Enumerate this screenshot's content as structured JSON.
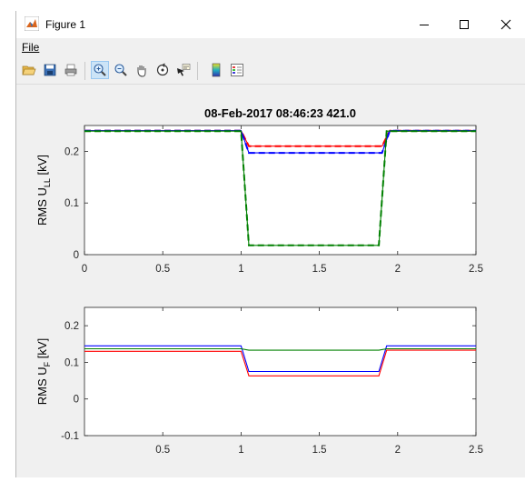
{
  "window": {
    "title": "Figure 1",
    "app_icon": "matlab-icon"
  },
  "controls": {
    "minimize": "minimize-icon",
    "maximize": "maximize-icon",
    "close": "close-icon"
  },
  "menu": {
    "file": "File"
  },
  "toolbar": {
    "items": [
      {
        "name": "open-file",
        "icon": "folder-open-icon"
      },
      {
        "name": "save",
        "icon": "save-icon"
      },
      {
        "name": "print",
        "icon": "print-icon"
      },
      {
        "name": "zoom-in",
        "icon": "zoom-in-icon",
        "active": true
      },
      {
        "name": "zoom-out",
        "icon": "zoom-out-icon"
      },
      {
        "name": "pan",
        "icon": "pan-hand-icon"
      },
      {
        "name": "rotate-3d",
        "icon": "rotate-icon"
      },
      {
        "name": "data-cursor",
        "icon": "data-cursor-icon"
      },
      {
        "name": "colorbar",
        "icon": "colorbar-icon"
      },
      {
        "name": "legend",
        "icon": "legend-icon"
      }
    ]
  },
  "colors": {
    "blue": "#0000ff",
    "red": "#ff0000",
    "green": "#008000"
  },
  "chart_data": [
    {
      "type": "line",
      "title": "08-Feb-2017 08:46:23 421.0",
      "ylabel": "RMS U",
      "ylabel_sub": "LL",
      "ylabel_unit": " [kV]",
      "xlim": [
        0,
        2.5
      ],
      "ylim": [
        0,
        0.25
      ],
      "xticks": [
        "0",
        "0.5",
        "1",
        "1.5",
        "2",
        "2.5"
      ],
      "xtick_values": [
        0,
        0.5,
        1,
        1.5,
        2,
        2.5
      ],
      "yticks": [
        "0",
        "0.1",
        "0.2"
      ],
      "ytick_values": [
        0,
        0.1,
        0.2
      ],
      "series": [
        {
          "color": "red",
          "style": "solid",
          "x": [
            0,
            1.0,
            1.05,
            1.9,
            1.95,
            2.5
          ],
          "y": [
            0.24,
            0.24,
            0.21,
            0.21,
            0.24,
            0.24
          ]
        },
        {
          "color": "red",
          "style": "dashed",
          "x": [
            0,
            1.0,
            1.05,
            1.9,
            1.95,
            2.5
          ],
          "y": [
            0.24,
            0.24,
            0.21,
            0.21,
            0.24,
            0.24
          ]
        },
        {
          "color": "blue",
          "style": "solid",
          "x": [
            0,
            1.0,
            1.05,
            1.9,
            1.95,
            2.5
          ],
          "y": [
            0.24,
            0.24,
            0.197,
            0.197,
            0.24,
            0.24
          ]
        },
        {
          "color": "blue",
          "style": "dashed",
          "x": [
            0,
            1.0,
            1.05,
            1.9,
            1.95,
            2.5
          ],
          "y": [
            0.24,
            0.24,
            0.197,
            0.197,
            0.24,
            0.24
          ]
        },
        {
          "color": "green",
          "style": "solid",
          "x": [
            0,
            1.0,
            1.05,
            1.88,
            1.93,
            2.5
          ],
          "y": [
            0.239,
            0.239,
            0.018,
            0.018,
            0.239,
            0.239
          ]
        },
        {
          "color": "green",
          "style": "dashed",
          "x": [
            0,
            1.0,
            1.05,
            1.88,
            1.93,
            2.5
          ],
          "y": [
            0.239,
            0.239,
            0.018,
            0.018,
            0.239,
            0.239
          ]
        }
      ]
    },
    {
      "type": "line",
      "ylabel": "RMS U",
      "ylabel_sub": "F",
      "ylabel_unit": " [kV]",
      "xlim": [
        0,
        2.5
      ],
      "ylim": [
        -0.1,
        0.25
      ],
      "xticks": [
        "0.5",
        "1",
        "1.5",
        "2",
        "2.5"
      ],
      "xtick_values": [
        0.5,
        1,
        1.5,
        2,
        2.5
      ],
      "yticks": [
        "-0.1",
        "0",
        "0.1",
        "0.2"
      ],
      "ytick_values": [
        -0.1,
        0,
        0.1,
        0.2
      ],
      "series": [
        {
          "color": "blue",
          "style": "solid",
          "x": [
            0,
            1.0,
            1.05,
            1.88,
            1.93,
            2.5
          ],
          "y": [
            0.145,
            0.145,
            0.075,
            0.075,
            0.145,
            0.145
          ]
        },
        {
          "color": "red",
          "style": "solid",
          "x": [
            0,
            1.0,
            1.05,
            1.88,
            1.93,
            2.5
          ],
          "y": [
            0.13,
            0.13,
            0.063,
            0.063,
            0.133,
            0.133
          ]
        },
        {
          "color": "green",
          "style": "solid",
          "x": [
            0,
            1.0,
            1.05,
            1.88,
            1.93,
            2.5
          ],
          "y": [
            0.137,
            0.137,
            0.133,
            0.133,
            0.137,
            0.137
          ]
        }
      ]
    }
  ]
}
